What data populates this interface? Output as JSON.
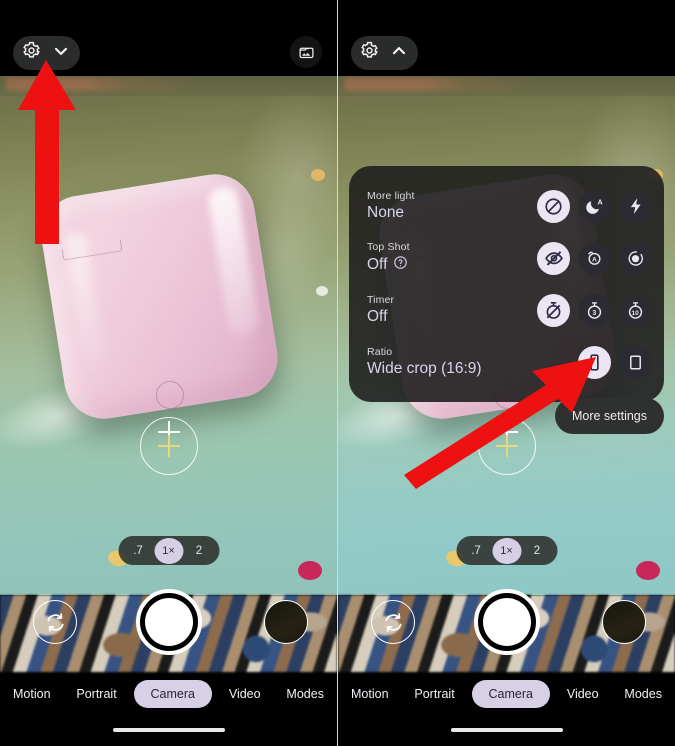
{
  "screens": [
    {
      "id": "before",
      "topbar": {
        "settings_icon": "gear-icon",
        "expander_icon": "chevron-down-icon",
        "gallery_icon": "gallery-icon"
      },
      "settings_panel_open": false,
      "annotation_arrow": "up-arrow pointing at chevron-down expander"
    },
    {
      "id": "after",
      "topbar": {
        "settings_icon": "gear-icon",
        "expander_icon": "chevron-up-icon"
      },
      "settings_panel_open": true,
      "annotation_arrow": "diagonal arrow pointing at selected 16:9 ratio option"
    }
  ],
  "settings_sheet": {
    "rows": [
      {
        "label": "More light",
        "value": "None",
        "has_help": false,
        "options": [
          {
            "icon": "no-flash-icon",
            "selected": true
          },
          {
            "icon": "night-sight-auto-icon",
            "selected": false
          },
          {
            "icon": "flash-on-icon",
            "selected": false
          }
        ]
      },
      {
        "label": "Top Shot",
        "value": "Off",
        "has_help": true,
        "help_icon": "help-circle-icon",
        "options": [
          {
            "icon": "top-shot-off-icon",
            "selected": true
          },
          {
            "icon": "top-shot-auto-icon",
            "selected": false
          },
          {
            "icon": "top-shot-on-icon",
            "selected": false
          }
        ]
      },
      {
        "label": "Timer",
        "value": "Off",
        "has_help": false,
        "options": [
          {
            "icon": "timer-off-icon",
            "selected": true
          },
          {
            "icon": "timer-3s-icon",
            "selected": false
          },
          {
            "icon": "timer-10s-icon",
            "selected": false
          }
        ]
      },
      {
        "label": "Ratio",
        "value": "Wide crop (16:9)",
        "has_help": false,
        "options": [
          {
            "icon": "ratio-16-9-icon",
            "selected": true
          },
          {
            "icon": "ratio-4-3-icon",
            "selected": false
          }
        ]
      }
    ],
    "more_settings_label": "More settings"
  },
  "zoom_bar": {
    "options": [
      {
        "label": ".7",
        "selected": false
      },
      {
        "label": "1×",
        "selected": true
      },
      {
        "label": "2",
        "selected": false
      }
    ]
  },
  "capture_controls": {
    "flip_icon": "camera-flip-icon",
    "shutter_icon": "shutter-button",
    "thumbnail_icon": "last-photo-thumbnail"
  },
  "mode_tabs": [
    {
      "label": "Motion",
      "selected": false
    },
    {
      "label": "Portrait",
      "selected": false
    },
    {
      "label": "Camera",
      "selected": true
    },
    {
      "label": "Video",
      "selected": false
    },
    {
      "label": "Modes",
      "selected": false
    }
  ],
  "colors": {
    "annotation_arrow": "#ee1111",
    "selected_pill": "#d8d0e6",
    "sheet_background": "#201f1f"
  }
}
